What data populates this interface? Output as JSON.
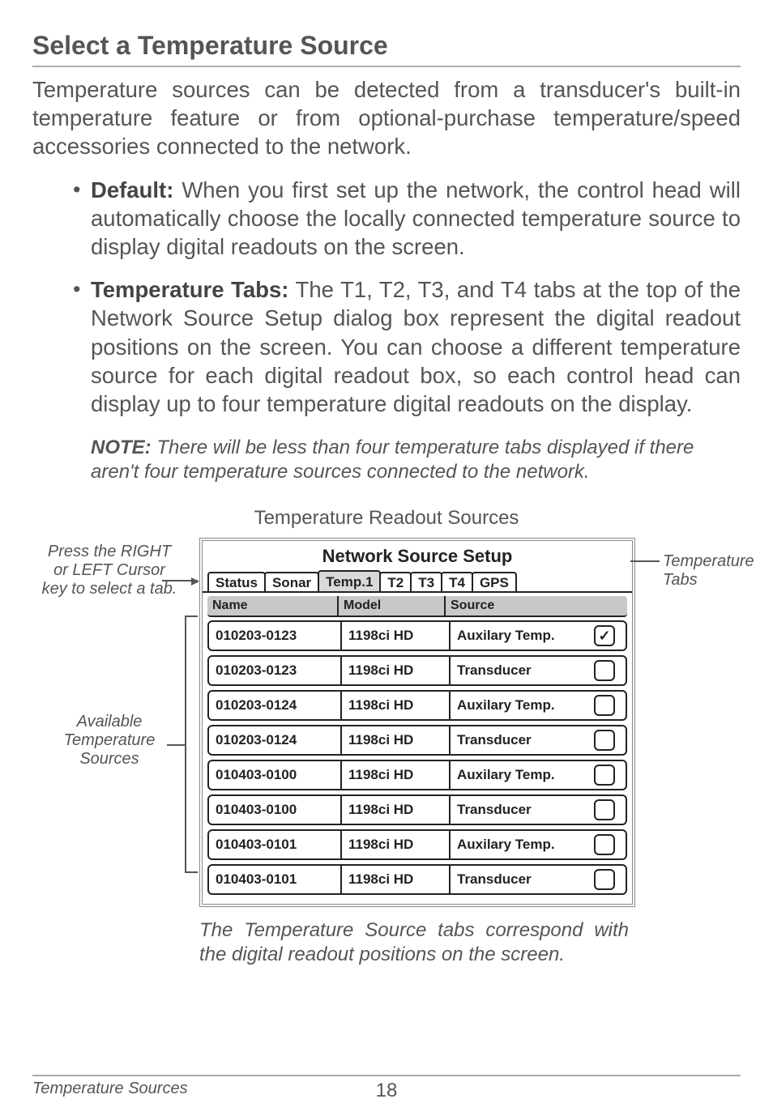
{
  "section_title": "Select a Temperature Source",
  "intro": "Temperature sources can be detected from a transducer's built-in temperature feature or from optional-purchase temperature/speed accessories connected to the network.",
  "bullets": [
    {
      "lead": "Default:",
      "text": " When you first set up the network, the control head will automatically choose the locally connected temperature source to display digital readouts on the screen."
    },
    {
      "lead": "Temperature Tabs:",
      "text": " The T1, T2, T3, and T4 tabs at the top of the Network Source Setup dialog box represent the digital readout positions on the screen. You can choose a different temperature source for each digital readout box, so each control head can display up to four temperature digital readouts on the display."
    }
  ],
  "note_lead": "NOTE:",
  "note_text": " There will be less than four temperature tabs displayed if there aren't four temperature sources connected to the network.",
  "figure_title": "Temperature Readout Sources",
  "callout_left_top": "Press the RIGHT or LEFT Cursor key to select a tab.",
  "callout_left_mid": "Available Temperature Sources",
  "callout_right": "Temperature Tabs",
  "dialog": {
    "title": "Network Source Setup",
    "tabs": [
      "Status",
      "Sonar",
      "Temp.1",
      "T2",
      "T3",
      "T4",
      "GPS"
    ],
    "active_tab_index": 2,
    "headers": {
      "name": "Name",
      "model": "Model",
      "source": "Source"
    },
    "rows": [
      {
        "name": "010203-0123",
        "model": "1198ci HD",
        "source": "Auxilary Temp.",
        "checked": true
      },
      {
        "name": "010203-0123",
        "model": "1198ci HD",
        "source": "Transducer",
        "checked": false
      },
      {
        "name": "010203-0124",
        "model": "1198ci HD",
        "source": "Auxilary Temp.",
        "checked": false
      },
      {
        "name": "010203-0124",
        "model": "1198ci HD",
        "source": "Transducer",
        "checked": false
      },
      {
        "name": "010403-0100",
        "model": "1198ci HD",
        "source": "Auxilary Temp.",
        "checked": false
      },
      {
        "name": "010403-0100",
        "model": "1198ci HD",
        "source": "Transducer",
        "checked": false
      },
      {
        "name": "010403-0101",
        "model": "1198ci HD",
        "source": "Auxilary Temp.",
        "checked": false
      },
      {
        "name": "010403-0101",
        "model": "1198ci HD",
        "source": "Transducer",
        "checked": false
      }
    ]
  },
  "caption": "The Temperature Source tabs correspond with the digital readout positions on the screen.",
  "footer_left": "Temperature Sources",
  "footer_page": "18"
}
